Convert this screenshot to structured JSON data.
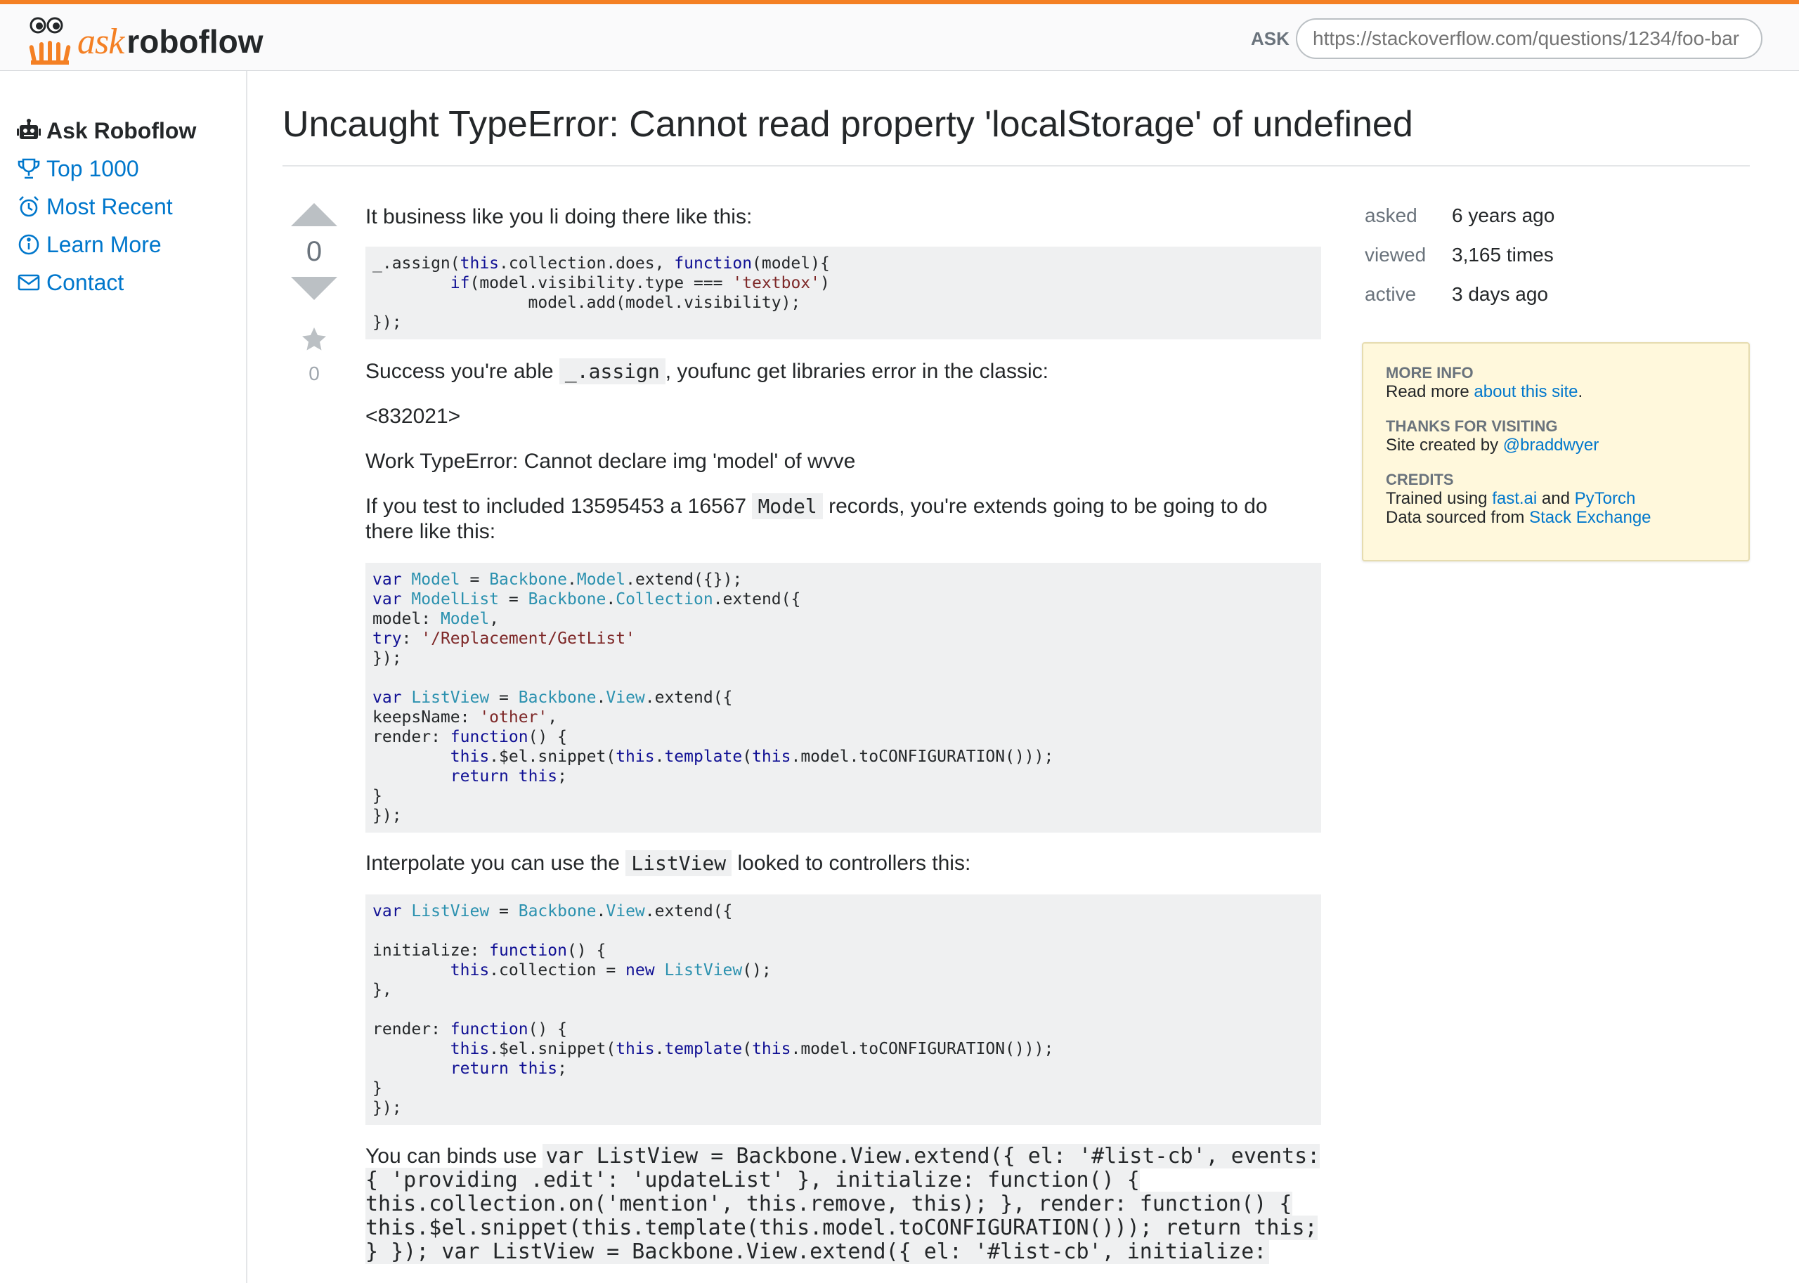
{
  "header": {
    "logo_ask": "ask",
    "logo_name": "roboflow",
    "ask_label": "ASK",
    "url_placeholder": "https://stackoverflow.com/questions/1234/foo-bar"
  },
  "sidebar": {
    "items": [
      {
        "label": "Ask Roboflow",
        "icon": "robot-icon"
      },
      {
        "label": "Top 1000",
        "icon": "trophy-icon"
      },
      {
        "label": "Most Recent",
        "icon": "alarm-clock-icon"
      },
      {
        "label": "Learn More",
        "icon": "info-icon"
      },
      {
        "label": "Contact",
        "icon": "envelope-icon"
      }
    ]
  },
  "question": {
    "title": "Uncaught TypeError: Cannot read property 'localStorage' of undefined",
    "votes": "0",
    "favorites": "0",
    "p1": "It business like you li doing there like this:",
    "p2_before": "Success you're able",
    "p2_code": "_.assign",
    "p2_after": ", youfunc get libraries error in the classic:",
    "p3": "<832021>",
    "p4": "Work TypeError: Cannot declare img 'model' of wvve",
    "p5_before": "If you test to included 13595453 a 16567",
    "p5_code": "Model",
    "p5_after": "records, you're extends going to be going to do there like this:",
    "p6_before": "Interpolate you can use the",
    "p6_code": "ListView",
    "p6_after": "looked to controllers this:",
    "p7_before": "You can binds use",
    "p7_code": "var ListView = Backbone.View.extend({ el: '#list-cb', events: { 'providing .edit': 'updateList' }, initialize: function() { this.collection.on('mention', this.remove, this); }, render: function() { this.$el.snippet(this.template(this.model.toCONFIGURATION())); return this; } }); var ListView = Backbone.View.extend({ el: '#list-cb', initialize:"
  },
  "meta": {
    "asked_label": "asked",
    "asked_value": "6 years ago",
    "viewed_label": "viewed",
    "viewed_value": "3,165 times",
    "active_label": "active",
    "active_value": "3 days ago"
  },
  "infobox": {
    "more_info_head": "MORE INFO",
    "more_info_text": "Read more",
    "more_info_link": "about this site",
    "more_info_end": ".",
    "thanks_head": "THANKS FOR VISITING",
    "thanks_text": "Site created by",
    "thanks_link": "@braddwyer",
    "credits_head": "CREDITS",
    "credits_text1": "Trained using",
    "credits_link1": "fast.ai",
    "credits_and": "and",
    "credits_link2": "PyTorch",
    "credits_text2": "Data sourced from",
    "credits_link3": "Stack Exchange"
  },
  "colors": {
    "accent": "#f48024",
    "link": "#0077cc",
    "infobox_bg": "#fff8dc"
  }
}
